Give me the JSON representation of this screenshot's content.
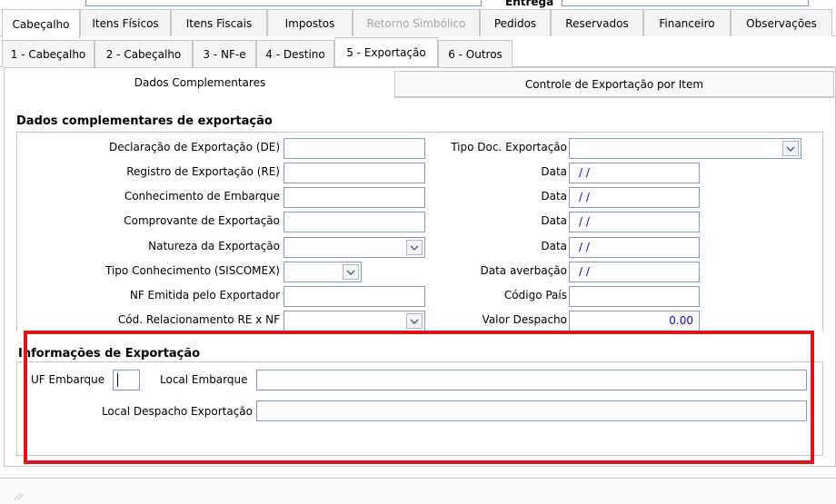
{
  "top": {
    "entrega_label": "Entrega"
  },
  "main_tabs": [
    {
      "label": "Cabeçalho",
      "state": "active"
    },
    {
      "label": "Itens Físicos",
      "state": "normal"
    },
    {
      "label": "Itens Fiscais",
      "state": "normal"
    },
    {
      "label": "Impostos",
      "state": "normal"
    },
    {
      "label": "Retorno Simbólico",
      "state": "disabled"
    },
    {
      "label": "Pedidos",
      "state": "normal"
    },
    {
      "label": "Reservados",
      "state": "normal"
    },
    {
      "label": "Financeiro",
      "state": "normal"
    },
    {
      "label": "Observações",
      "state": "normal"
    }
  ],
  "sub_tabs": [
    {
      "label": "1 - Cabeçalho"
    },
    {
      "label": "2 - Cabeçalho"
    },
    {
      "label": "3 - NF-e"
    },
    {
      "label": "4 - Destino"
    },
    {
      "label": "5 - Exportação"
    },
    {
      "label": "6 - Outros"
    }
  ],
  "inner_tabs": {
    "dados_complementares": "Dados Complementares",
    "controle_exportacao": "Controle de Exportação por Item"
  },
  "section1": {
    "title": "Dados complementares de exportação",
    "declaracao_exportacao": {
      "label": "Declaração de Exportação (DE)",
      "value": ""
    },
    "registro_exportacao": {
      "label": "Registro de Exportação (RE)",
      "value": ""
    },
    "conhecimento_embarque": {
      "label": "Conhecimento de Embarque",
      "value": ""
    },
    "comprovante_exportacao": {
      "label": "Comprovante de Exportação",
      "value": ""
    },
    "natureza_exportacao": {
      "label": "Natureza da Exportação",
      "value": ""
    },
    "tipo_conhecimento": {
      "label": "Tipo Conhecimento (SISCOMEX)",
      "value": ""
    },
    "nf_emitida": {
      "label": "NF Emitida pelo Exportador",
      "value": ""
    },
    "cod_relacionamento": {
      "label": "Cód. Relacionamento RE x NF",
      "value": ""
    },
    "tipo_doc_exportacao": {
      "label": "Tipo Doc. Exportação",
      "value": ""
    },
    "data1": {
      "label": "Data",
      "value": "/ /"
    },
    "data2": {
      "label": "Data",
      "value": "/ /"
    },
    "data3": {
      "label": "Data",
      "value": "/ /"
    },
    "data4": {
      "label": "Data",
      "value": "/ /"
    },
    "data_averbacao": {
      "label": "Data averbação",
      "value": "/ /"
    },
    "codigo_pais": {
      "label": "Código País",
      "value": ""
    },
    "valor_despacho": {
      "label": "Valor Despacho",
      "value": "0.00"
    }
  },
  "section2": {
    "title": "Informações de Exportação",
    "uf_embarque": {
      "label": "UF Embarque",
      "value": ""
    },
    "local_embarque": {
      "label": "Local Embarque",
      "value": ""
    },
    "local_despacho": {
      "label": "Local Despacho Exportação",
      "value": ""
    }
  },
  "colors": {
    "highlight": "#e0141b",
    "value_blue": "#0000ff",
    "input_border": "#7f9db9"
  },
  "icons": {
    "dropdown": "chevron-down-icon",
    "resize_grip": "resize-grip-icon"
  }
}
